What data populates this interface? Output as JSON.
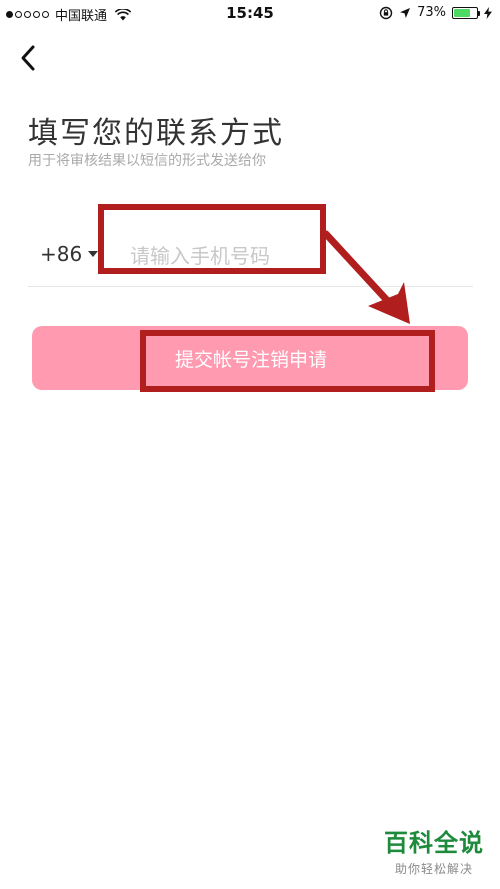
{
  "status_bar": {
    "carrier": "中国联通",
    "time": "15:45",
    "battery_percent": "73%",
    "battery_level": 0.73,
    "signal_bars_filled": 1,
    "signal_bars_total": 5
  },
  "header": {
    "back_icon": "chevron-left-icon"
  },
  "main": {
    "title": "填写您的联系方式",
    "subtitle": "用于将审核结果以短信的形式发送给你",
    "country_code": "+86",
    "phone_placeholder": "请输入手机号码",
    "phone_value": "",
    "submit_label": "提交帐号注销申请"
  },
  "colors": {
    "submit_bg": "#ff9ab0",
    "annotation": "#b01e1e",
    "battery": "#4cd964",
    "watermark": "#1e8a3c"
  },
  "watermark": {
    "main": "百科全说",
    "sub": "助你轻松解决"
  }
}
